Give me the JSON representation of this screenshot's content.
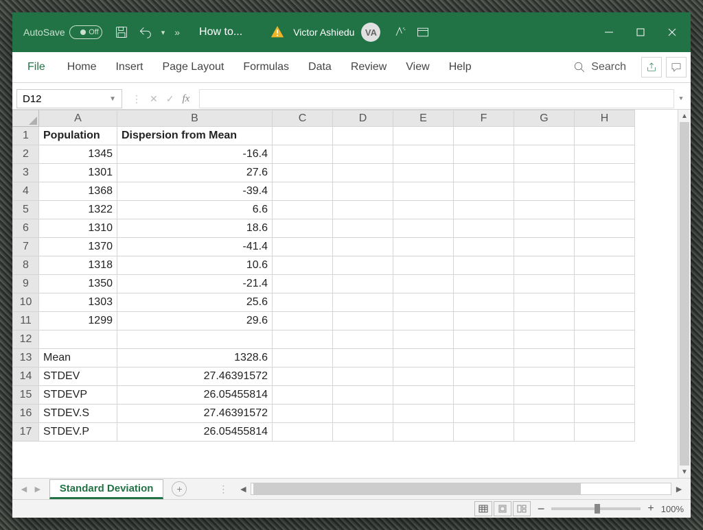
{
  "title": {
    "autosave": "AutoSave",
    "autosave_state": "Off",
    "doc": "How to...",
    "user": "Victor Ashiedu",
    "initials": "VA"
  },
  "ribbon": {
    "file": "File",
    "tabs": [
      "Home",
      "Insert",
      "Page Layout",
      "Formulas",
      "Data",
      "Review",
      "View",
      "Help"
    ],
    "search": "Search"
  },
  "formula": {
    "name_box": "D12",
    "fx": "fx"
  },
  "columns": [
    "A",
    "B",
    "C",
    "D",
    "E",
    "F",
    "G",
    "H"
  ],
  "rows": [
    {
      "n": "1",
      "A": "Population",
      "B": "Dispersion from Mean",
      "Atype": "hdr",
      "Btype": "hdr"
    },
    {
      "n": "2",
      "A": "1345",
      "B": "-16.4"
    },
    {
      "n": "3",
      "A": "1301",
      "B": "27.6"
    },
    {
      "n": "4",
      "A": "1368",
      "B": "-39.4"
    },
    {
      "n": "5",
      "A": "1322",
      "B": "6.6"
    },
    {
      "n": "6",
      "A": "1310",
      "B": "18.6"
    },
    {
      "n": "7",
      "A": "1370",
      "B": "-41.4"
    },
    {
      "n": "8",
      "A": "1318",
      "B": "10.6"
    },
    {
      "n": "9",
      "A": "1350",
      "B": "-21.4"
    },
    {
      "n": "10",
      "A": "1303",
      "B": "25.6"
    },
    {
      "n": "11",
      "A": "1299",
      "B": "29.6"
    },
    {
      "n": "12",
      "A": "",
      "B": ""
    },
    {
      "n": "13",
      "A": "Mean",
      "B": "1328.6",
      "Atype": "left"
    },
    {
      "n": "14",
      "A": "STDEV",
      "B": "27.46391572",
      "Atype": "left"
    },
    {
      "n": "15",
      "A": "STDEVP",
      "B": "26.05455814",
      "Atype": "left"
    },
    {
      "n": "16",
      "A": "STDEV.S",
      "B": "27.46391572",
      "Atype": "left"
    },
    {
      "n": "17",
      "A": "STDEV.P",
      "B": "26.05455814",
      "Atype": "left"
    }
  ],
  "sheet_tab": "Standard Deviation",
  "zoom": "100%"
}
